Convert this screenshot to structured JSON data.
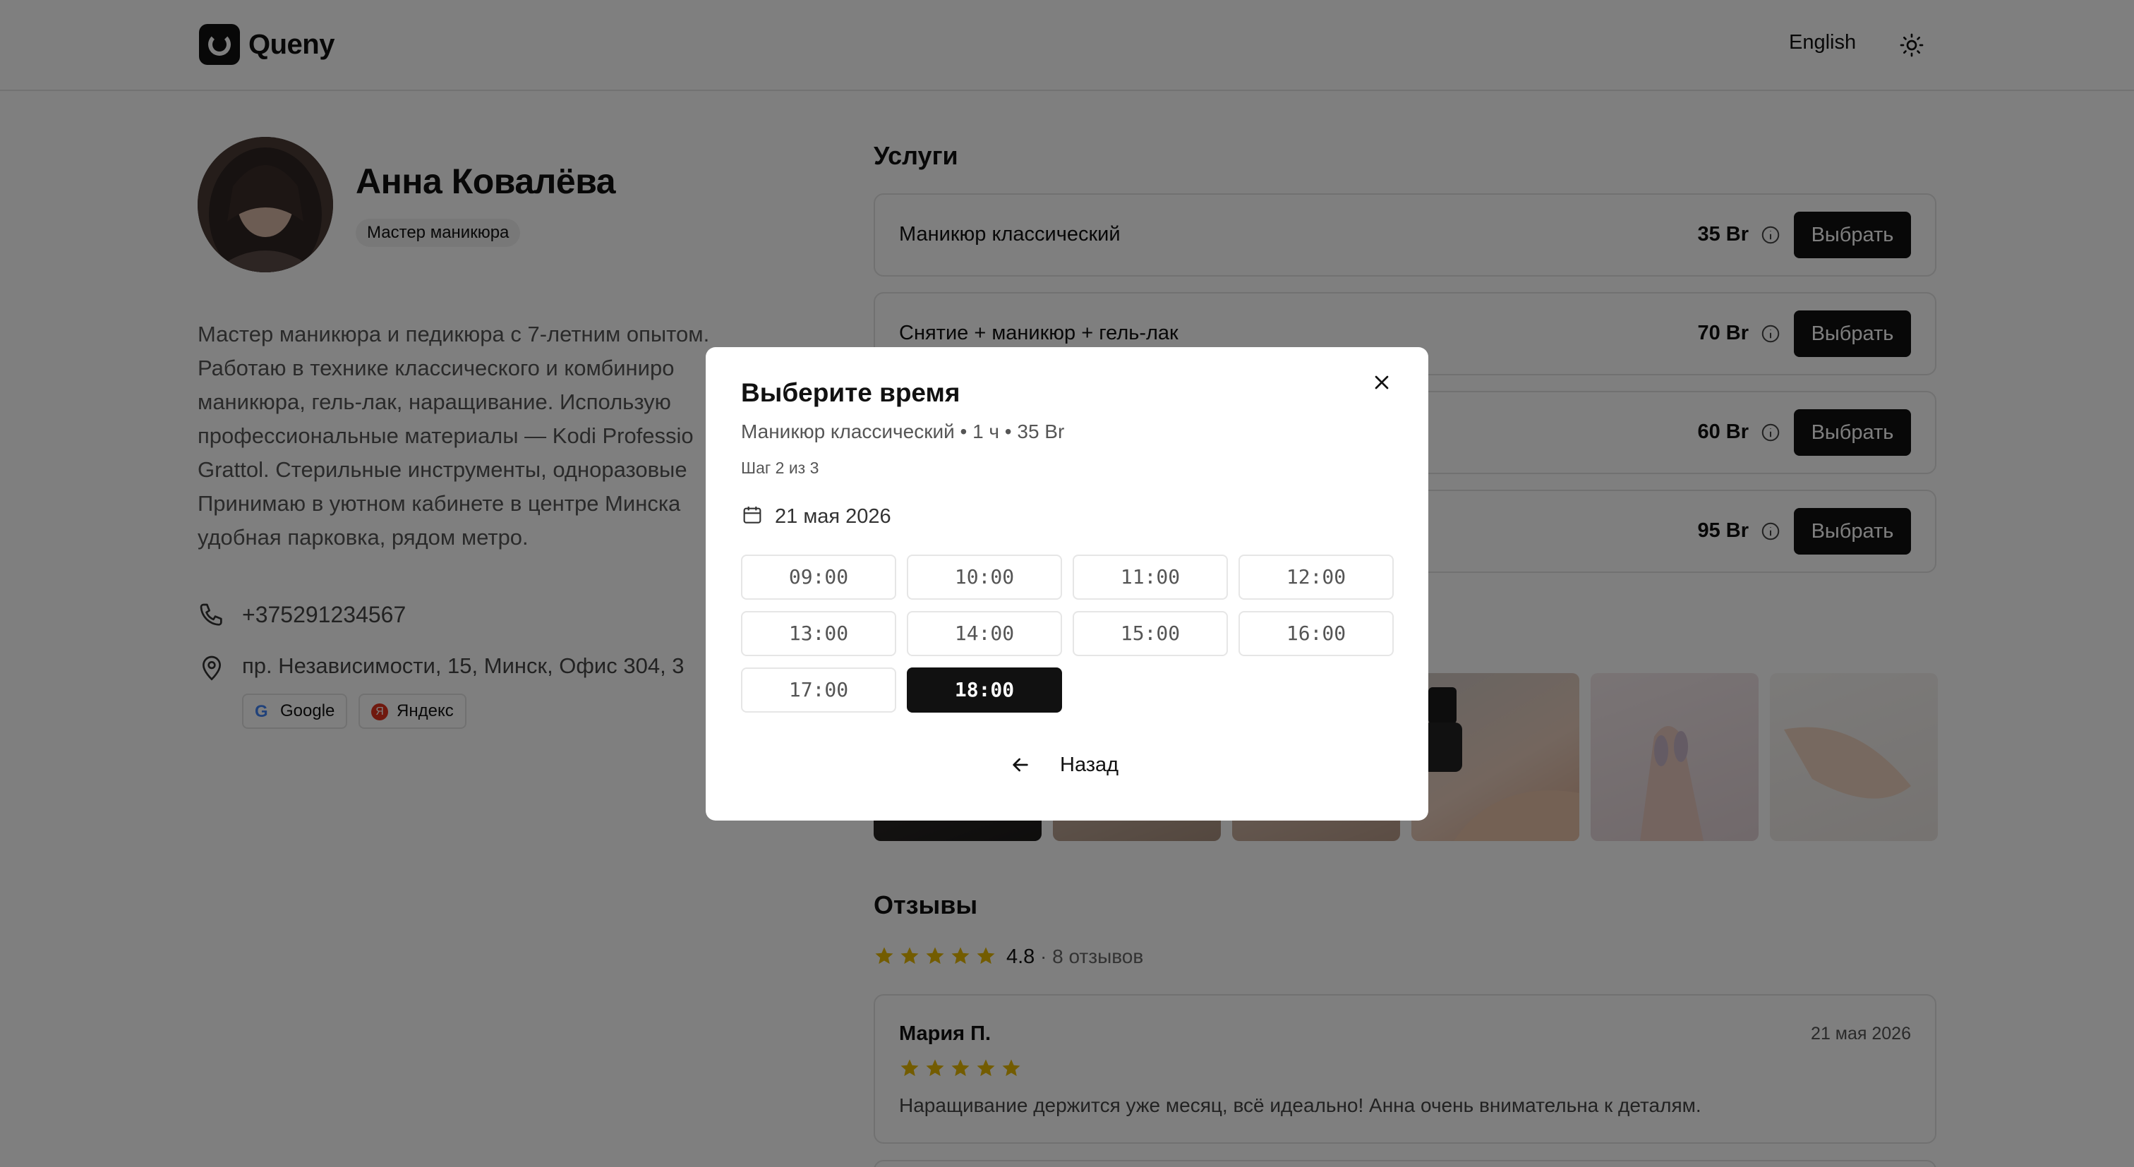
{
  "header": {
    "brand": "Queny",
    "language": "English"
  },
  "profile": {
    "name": "Анна Ковалёва",
    "role": "Мастер маникюра",
    "bio_lines": [
      "Мастер маникюра и педикюра с 7-летним опытом.",
      "Работаю в технике классического и комбиниро",
      "маникюра, гель-лак, наращивание. Использую",
      "профессиональные материалы — Kodi Professio",
      "Grattol. Стерильные инструменты, одноразовые",
      "Принимаю в уютном кабинете в центре Минска",
      "удобная парковка, рядом метро."
    ],
    "phone": "+375291234567",
    "address": "пр. Независимости, 15, Минск, Офис 304, 3",
    "map_google": "Google",
    "map_yandex": "Яндекс",
    "yandex_badge": "Я"
  },
  "services": {
    "title": "Услуги",
    "items": [
      {
        "name": "Маникюр классический",
        "price": "35 Br",
        "button": "Выбрать"
      },
      {
        "name": "Снятие + маникюр + гель-лак",
        "price": "70 Br",
        "button": "Выбрать"
      },
      {
        "name": "",
        "price": "60 Br",
        "button": "Выбрать"
      },
      {
        "name": "",
        "price": "95 Br",
        "button": "Выбрать"
      }
    ]
  },
  "reviews": {
    "title": "Отзывы",
    "rating": "4.8",
    "rating_stars": 5,
    "count": "· 8 отзывов",
    "items": [
      {
        "author": "Мария П.",
        "date": "21 мая 2026",
        "stars": 5,
        "text": "Наращивание держится уже месяц, всё идеально! Анна очень внимательна к деталям."
      }
    ]
  },
  "modal": {
    "title": "Выберите время",
    "subtitle": "Маникюр классический • 1 ч • 35 Br",
    "step": "Шаг 2 из 3",
    "date": "21 мая 2026",
    "slots": [
      "09:00",
      "10:00",
      "11:00",
      "12:00",
      "13:00",
      "14:00",
      "15:00",
      "16:00",
      "17:00",
      "18:00"
    ],
    "selected_slot": "18:00",
    "back_label": "Назад"
  },
  "colors": {
    "accent": "#111111",
    "star": "#e6b800",
    "overlay": "rgba(0,0,0,0.5)"
  },
  "icons": [
    "sun-icon",
    "info-icon",
    "phone-icon",
    "map-pin-icon",
    "calendar-icon",
    "close-icon",
    "arrow-left-icon",
    "star-icon"
  ]
}
